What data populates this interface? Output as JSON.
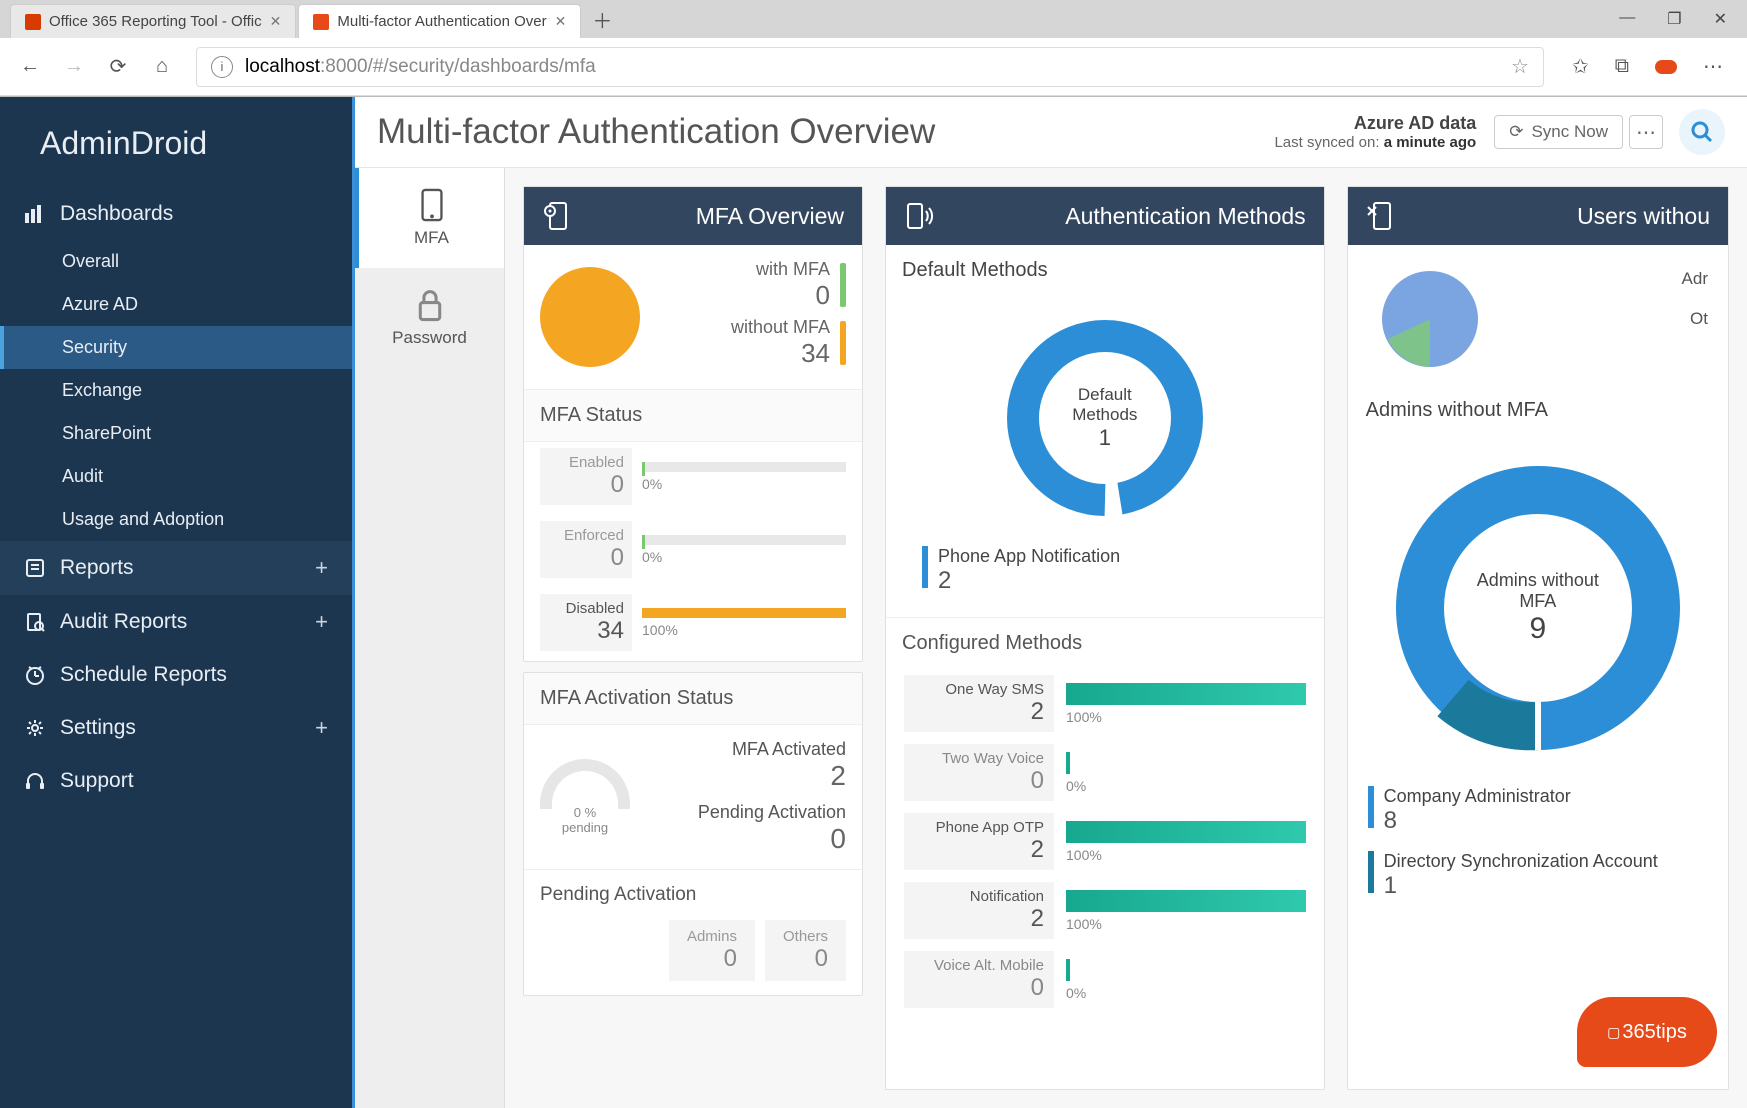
{
  "browser": {
    "tabs": [
      {
        "favicon": "office",
        "title": "Office 365 Reporting Tool - Offic"
      },
      {
        "favicon": "ad",
        "title": "Multi-factor Authentication Over"
      }
    ],
    "url_host": "localhost",
    "url_port": ":8000",
    "url_path": "/#/security/dashboards/mfa"
  },
  "app": {
    "brand": "AdminDroid",
    "sidebar": {
      "dashboards": "Dashboards",
      "dash_items": [
        "Overall",
        "Azure AD",
        "Security",
        "Exchange",
        "SharePoint",
        "Audit",
        "Usage and Adoption"
      ],
      "reports": "Reports",
      "audit_reports": "Audit Reports",
      "schedule": "Schedule Reports",
      "settings": "Settings",
      "support": "Support"
    },
    "header": {
      "title": "Multi-factor Authentication Overview",
      "azure": "Azure AD data",
      "synced_prefix": "Last synced on: ",
      "synced_value": "a minute ago",
      "sync_btn": "Sync Now"
    },
    "mini_nav": [
      {
        "label": "MFA",
        "icon": "phone"
      },
      {
        "label": "Password",
        "icon": "lock"
      }
    ],
    "card_overview": {
      "title": "MFA Overview",
      "with_lbl": "with MFA",
      "with_val": "0",
      "without_lbl": "without MFA",
      "without_val": "34",
      "status_title": "MFA Status",
      "status": [
        {
          "lbl": "Enabled",
          "val": "0",
          "pct": "0%",
          "fill": 0
        },
        {
          "lbl": "Enforced",
          "val": "0",
          "pct": "0%",
          "fill": 0
        },
        {
          "lbl": "Disabled",
          "val": "34",
          "pct": "100%",
          "fill": 100
        }
      ],
      "act_title": "MFA Activation Status",
      "gauge_top": "0 %",
      "gauge_bottom": "pending",
      "act_rows": [
        {
          "lbl": "MFA Activated",
          "val": "2"
        },
        {
          "lbl": "Pending Activation",
          "val": "0"
        }
      ],
      "pending_title": "Pending Activation",
      "pending_cols": [
        {
          "lbl": "Admins",
          "val": "0"
        },
        {
          "lbl": "Others",
          "val": "0"
        }
      ]
    },
    "card_auth": {
      "title": "Authentication Methods",
      "default_title": "Default Methods",
      "donut_center_lbl": "Default Methods",
      "donut_center_val": "1",
      "default_legend": {
        "lbl": "Phone App Notification",
        "val": "2"
      },
      "configured_title": "Configured Methods",
      "configured": [
        {
          "lbl": "One Way SMS",
          "val": "2",
          "pct": "100%",
          "fill": 100
        },
        {
          "lbl": "Two Way Voice",
          "val": "0",
          "pct": "0%",
          "fill": 0
        },
        {
          "lbl": "Phone App OTP",
          "val": "2",
          "pct": "100%",
          "fill": 100
        },
        {
          "lbl": "Notification",
          "val": "2",
          "pct": "100%",
          "fill": 100
        },
        {
          "lbl": "Voice Alt. Mobile",
          "val": "0",
          "pct": "0%",
          "fill": 0
        }
      ]
    },
    "card_users": {
      "title": "Users withou",
      "small_labels": [
        "Adr",
        "Ot"
      ],
      "admins_title": "Admins without MFA",
      "donut_center_lbl": "Admins without MFA",
      "donut_center_val": "9",
      "legend": [
        {
          "lbl": "Company Administrator",
          "val": "8"
        },
        {
          "lbl": "Directory Synchronization Account",
          "val": "1"
        }
      ]
    },
    "badge": "365tips"
  },
  "chart_data": [
    {
      "type": "pie",
      "title": "MFA Overview",
      "series": [
        {
          "name": "with MFA",
          "value": 0
        },
        {
          "name": "without MFA",
          "value": 34
        }
      ]
    },
    {
      "type": "bar",
      "title": "MFA Status",
      "categories": [
        "Enabled",
        "Enforced",
        "Disabled"
      ],
      "values": [
        0,
        0,
        34
      ],
      "percent": [
        0,
        0,
        100
      ]
    },
    {
      "type": "pie",
      "title": "Default Methods",
      "series": [
        {
          "name": "Phone App Notification",
          "value": 2
        }
      ],
      "total": 1
    },
    {
      "type": "bar",
      "title": "Configured Methods",
      "categories": [
        "One Way SMS",
        "Two Way Voice",
        "Phone App OTP",
        "Notification",
        "Voice Alt. Mobile"
      ],
      "values": [
        2,
        0,
        2,
        2,
        0
      ],
      "percent": [
        100,
        0,
        100,
        100,
        0
      ]
    },
    {
      "type": "pie",
      "title": "Admins without MFA",
      "series": [
        {
          "name": "Company Administrator",
          "value": 8
        },
        {
          "name": "Directory Synchronization Account",
          "value": 1
        }
      ],
      "total": 9
    }
  ]
}
